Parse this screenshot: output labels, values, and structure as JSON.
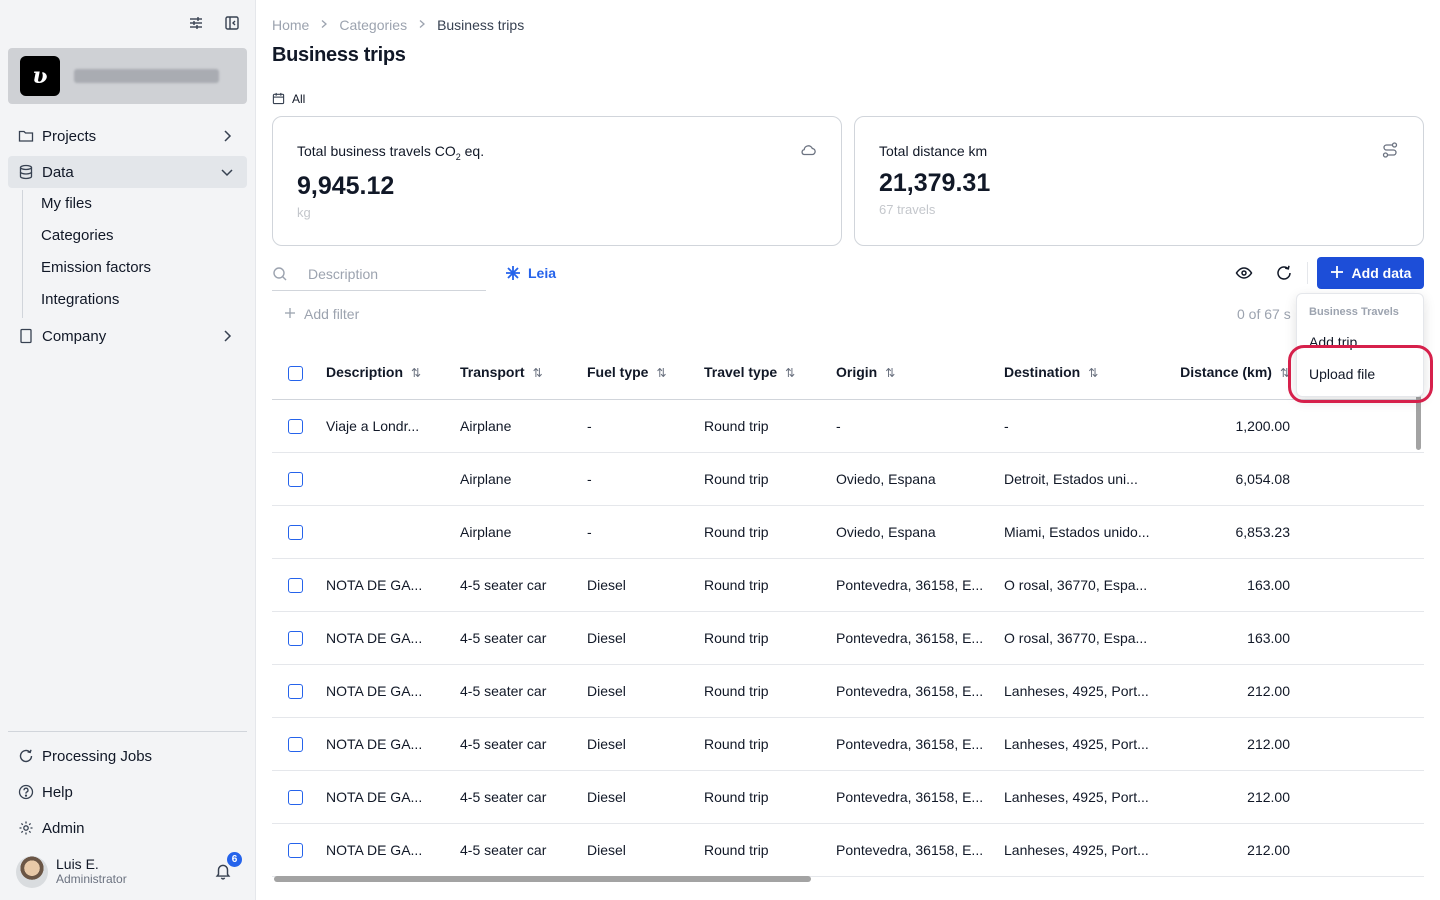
{
  "sidebar": {
    "items": [
      {
        "label": "Projects",
        "icon": "folder-icon"
      },
      {
        "label": "Data",
        "icon": "database-icon"
      },
      {
        "label": "Company",
        "icon": "building-icon"
      }
    ],
    "data_subitems": [
      "My files",
      "Categories",
      "Emission factors",
      "Integrations"
    ],
    "bottom_items": [
      {
        "label": "Processing Jobs",
        "icon": "refresh-icon"
      },
      {
        "label": "Help",
        "icon": "help-icon"
      },
      {
        "label": "Admin",
        "icon": "gear-icon"
      }
    ],
    "org_logo_letter": "ʋ",
    "user": {
      "name": "Luis E.",
      "role": "Administrator",
      "notifications": "6"
    }
  },
  "breadcrumb": [
    "Home",
    "Categories",
    "Business trips"
  ],
  "page_title": "Business trips",
  "period_filter": "All",
  "cards": [
    {
      "label_main": "Total business travels CO",
      "label_sub": "2",
      "label_tail": " eq.",
      "value": "9,945.12",
      "unit": "kg",
      "icon": "cloud-icon"
    },
    {
      "label_main": "Total distance km",
      "label_sub": "",
      "label_tail": "",
      "value": "21,379.31",
      "unit": "67 travels",
      "icon": "route-icon"
    }
  ],
  "toolbar": {
    "search_placeholder": "Description",
    "leia_label": "Leia",
    "add_data_label": "Add data",
    "add_filter_label": "Add filter",
    "count_label": "0 of 67 s"
  },
  "table": {
    "columns": [
      "Description",
      "Transport",
      "Fuel type",
      "Travel type",
      "Origin",
      "Destination",
      "Distance (km)"
    ],
    "rows": [
      [
        "Viaje a Londr...",
        "Airplane",
        "-",
        "Round trip",
        "-",
        "-",
        "1,200.00"
      ],
      [
        "",
        "Airplane",
        "-",
        "Round trip",
        "Oviedo, Espana",
        "Detroit, Estados uni...",
        "6,054.08"
      ],
      [
        "",
        "Airplane",
        "-",
        "Round trip",
        "Oviedo, Espana",
        "Miami, Estados unido...",
        "6,853.23"
      ],
      [
        "NOTA DE GA...",
        "4-5 seater car",
        "Diesel",
        "Round trip",
        "Pontevedra, 36158, E...",
        "O rosal, 36770, Espa...",
        "163.00"
      ],
      [
        "NOTA DE GA...",
        "4-5 seater car",
        "Diesel",
        "Round trip",
        "Pontevedra, 36158, E...",
        "O rosal, 36770, Espa...",
        "163.00"
      ],
      [
        "NOTA DE GA...",
        "4-5 seater car",
        "Diesel",
        "Round trip",
        "Pontevedra, 36158, E...",
        "Lanheses, 4925, Port...",
        "212.00"
      ],
      [
        "NOTA DE GA...",
        "4-5 seater car",
        "Diesel",
        "Round trip",
        "Pontevedra, 36158, E...",
        "Lanheses, 4925, Port...",
        "212.00"
      ],
      [
        "NOTA DE GA...",
        "4-5 seater car",
        "Diesel",
        "Round trip",
        "Pontevedra, 36158, E...",
        "Lanheses, 4925, Port...",
        "212.00"
      ],
      [
        "NOTA DE GA...",
        "4-5 seater car",
        "Diesel",
        "Round trip",
        "Pontevedra, 36158, E...",
        "Lanheses, 4925, Port...",
        "212.00"
      ]
    ]
  },
  "dropdown": {
    "header": "Business Travels",
    "items": [
      "Add trip",
      "Upload file"
    ]
  },
  "colors": {
    "accent": "#1d4ed8",
    "highlight": "#d6204b"
  }
}
